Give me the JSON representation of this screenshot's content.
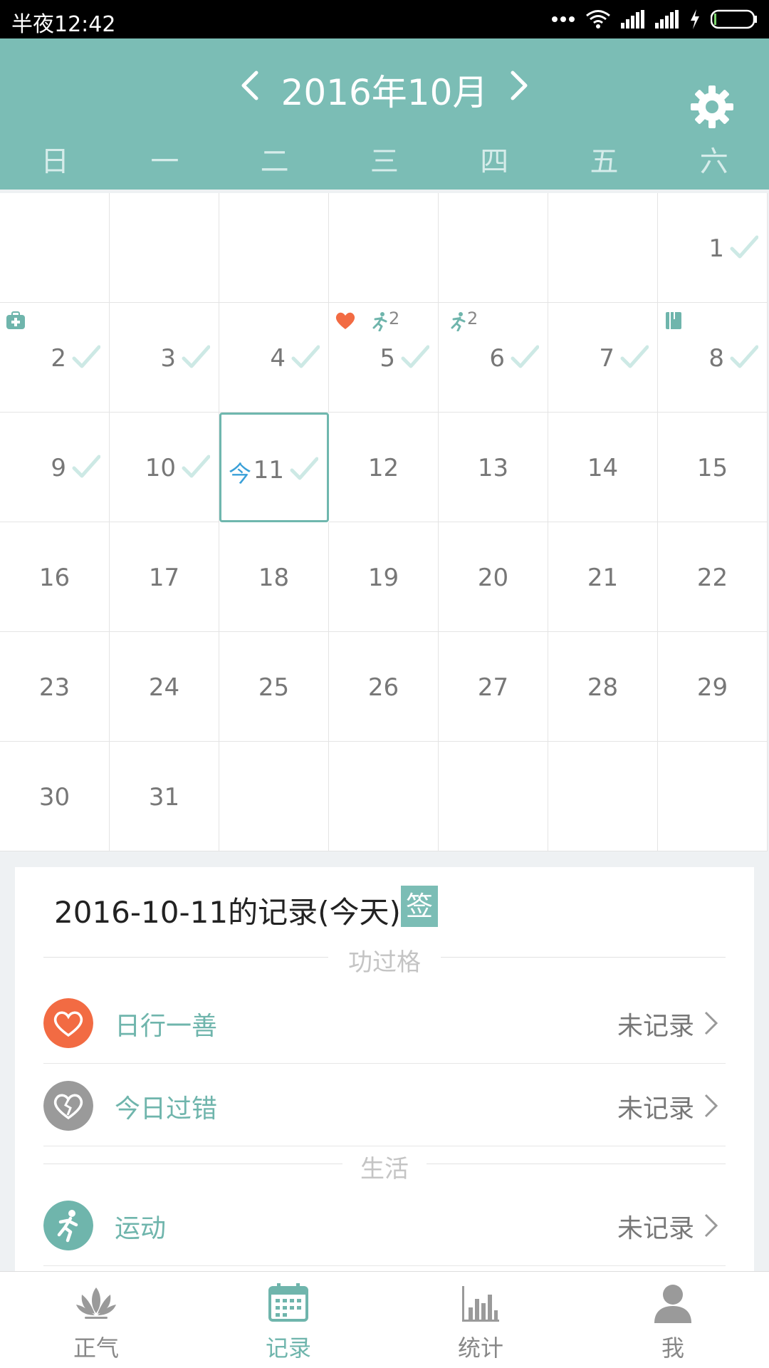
{
  "status_bar": {
    "time": "半夜12:42"
  },
  "header": {
    "month_title": "2016年10月"
  },
  "weekdays": [
    "日",
    "一",
    "二",
    "三",
    "四",
    "五",
    "六"
  ],
  "calendar": {
    "today_mark": "今",
    "days": [
      {
        "day": ""
      },
      {
        "day": ""
      },
      {
        "day": ""
      },
      {
        "day": ""
      },
      {
        "day": ""
      },
      {
        "day": ""
      },
      {
        "day": "1",
        "checked": true
      },
      {
        "day": "2",
        "checked": true,
        "event": "medkit"
      },
      {
        "day": "3",
        "checked": true
      },
      {
        "day": "4",
        "checked": true
      },
      {
        "day": "5",
        "checked": true,
        "event": "heart-run",
        "count": "2"
      },
      {
        "day": "6",
        "checked": true,
        "event": "run",
        "count": "2"
      },
      {
        "day": "7",
        "checked": true
      },
      {
        "day": "8",
        "checked": true,
        "event": "book"
      },
      {
        "day": "9",
        "checked": true
      },
      {
        "day": "10",
        "checked": true
      },
      {
        "day": "11",
        "checked": true,
        "today": true
      },
      {
        "day": "12"
      },
      {
        "day": "13"
      },
      {
        "day": "14"
      },
      {
        "day": "15"
      },
      {
        "day": "16"
      },
      {
        "day": "17"
      },
      {
        "day": "18"
      },
      {
        "day": "19"
      },
      {
        "day": "20"
      },
      {
        "day": "21"
      },
      {
        "day": "22"
      },
      {
        "day": "23"
      },
      {
        "day": "24"
      },
      {
        "day": "25"
      },
      {
        "day": "26"
      },
      {
        "day": "27"
      },
      {
        "day": "28"
      },
      {
        "day": "29"
      },
      {
        "day": "30"
      },
      {
        "day": "31"
      },
      {
        "day": ""
      },
      {
        "day": ""
      },
      {
        "day": ""
      },
      {
        "day": ""
      },
      {
        "day": ""
      }
    ]
  },
  "record": {
    "title": "2016-10-11的记录(今天)",
    "sign_label": "签",
    "section_merit": "功过格",
    "section_life": "生活",
    "rows": [
      {
        "label": "日行一善",
        "status": "未记录",
        "icon": "heart-icon",
        "color": "#f26b43"
      },
      {
        "label": "今日过错",
        "status": "未记录",
        "icon": "broken-heart-icon",
        "color": "#9a9a9a"
      },
      {
        "label": "运动",
        "status": "未记录",
        "icon": "running-icon",
        "color": "#6fb5ac"
      }
    ]
  },
  "bottom_nav": [
    {
      "label": "正气",
      "icon": "lotus-icon",
      "active": false
    },
    {
      "label": "记录",
      "icon": "calendar-icon",
      "active": true
    },
    {
      "label": "统计",
      "icon": "bar-chart-icon",
      "active": false
    },
    {
      "label": "我",
      "icon": "person-icon",
      "active": false
    }
  ],
  "colors": {
    "accent": "#7bbdb5",
    "good": "#f26b43",
    "check": "#cde9e5",
    "today_text": "#3aa0d8"
  }
}
